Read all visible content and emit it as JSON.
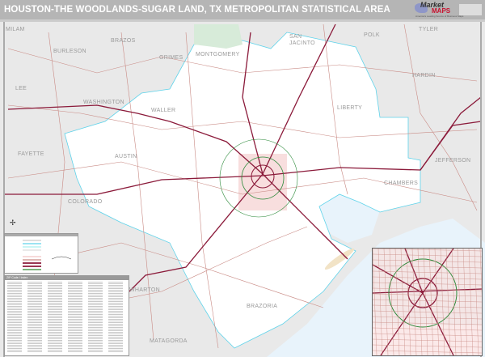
{
  "title": "HOUSTON-THE WOODLANDS-SUGAR LAND, TX METROPOLITAN STATISTICAL AREA",
  "logo": {
    "brand_top": "Market",
    "brand_bottom": "MAPS",
    "tagline": "America's Leading Source of Business Maps"
  },
  "counties": [
    {
      "name": "MILAM"
    },
    {
      "name": "BRAZOS"
    },
    {
      "name": "BURLESON"
    },
    {
      "name": "GRIMES"
    },
    {
      "name": "MONTGOMERY"
    },
    {
      "name": "SAN JACINTO"
    },
    {
      "name": "POLK"
    },
    {
      "name": "TYLER"
    },
    {
      "name": "LEE"
    },
    {
      "name": "WASHINGTON"
    },
    {
      "name": "WALLER"
    },
    {
      "name": "AUSTIN"
    },
    {
      "name": "FAYETTE"
    },
    {
      "name": "COLORADO"
    },
    {
      "name": "LIBERTY"
    },
    {
      "name": "HARDIN"
    },
    {
      "name": "JEFFERSON"
    },
    {
      "name": "CHAMBERS"
    },
    {
      "name": "WHARTON"
    },
    {
      "name": "MATAGORDA"
    },
    {
      "name": "BRAZORIA"
    }
  ],
  "index_header": "ZIP Code / Index",
  "colors": {
    "title_bar": "#b5b5b5",
    "land_outside": "#e9e9e9",
    "metro_area": "#ffffff",
    "water": "#e8f3fb",
    "highway": "#8b1a3a",
    "road": "#c98a84",
    "zip_boundary": "#5fd3ea",
    "urban": "#f6d6d6",
    "brand_red": "#c8102e"
  },
  "icons": [
    "compass-rose-icon",
    "market-maps-logo"
  ]
}
